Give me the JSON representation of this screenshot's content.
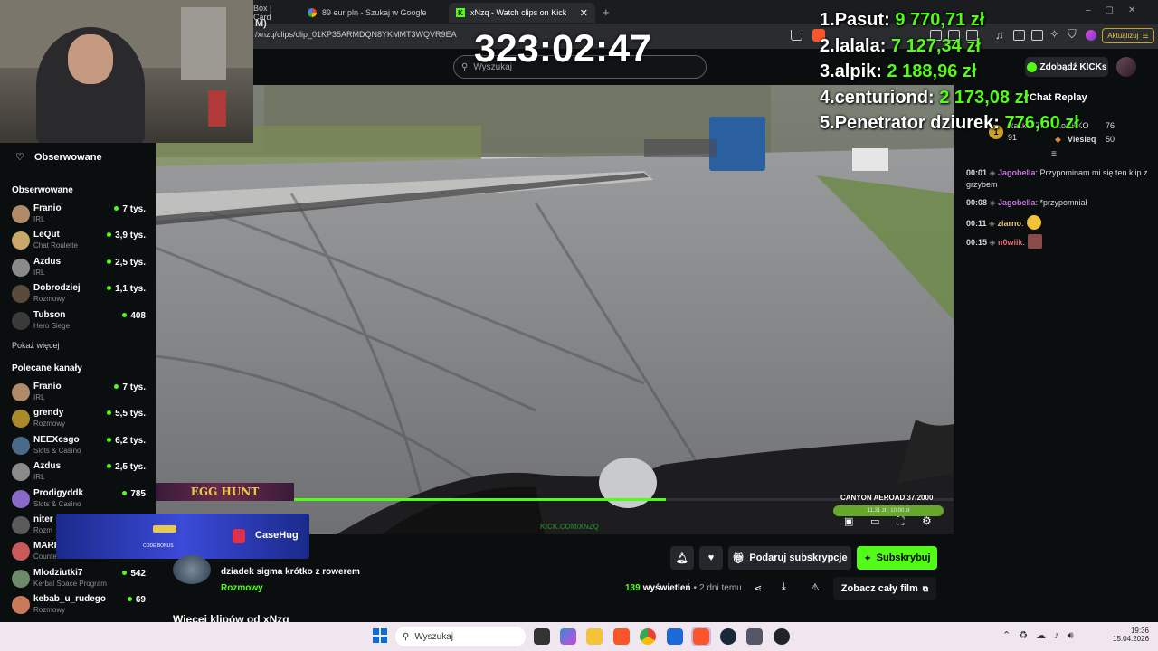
{
  "browser": {
    "tabs": [
      {
        "label": "Box | Card"
      },
      {
        "label": "89 eur pln - Szukaj w Google"
      },
      {
        "label": "xNzq - Watch clips on Kick"
      }
    ],
    "new_tab_glyph": "+",
    "url": "/xnzq/clips/clip_01KP35ARMDQN8YKMMT3WQVR9EA",
    "url_prefix_fragment": "M)",
    "update_label": "Aktualizuj"
  },
  "header": {
    "search_placeholder": "Wyszukaj",
    "kicks_label": "Zdobądź KICKs"
  },
  "stream_overlay": {
    "timer": "323:02:47",
    "leaderboard": [
      {
        "rank": "1.",
        "name": "Pasut:",
        "amount": "9 770,71 zł"
      },
      {
        "rank": "2.",
        "name": "lalala:",
        "amount": "7 127,34 zł"
      },
      {
        "rank": "3.",
        "name": "alpik:",
        "amount": "2 188,96 zł"
      },
      {
        "rank": "4.",
        "name": "centuriond:",
        "amount": "2 173,08 zł"
      },
      {
        "rank": "5.",
        "name": "Penetrator dziurek:",
        "amount": "776,60 zł"
      }
    ]
  },
  "sidebar": {
    "following_header": "Obserwowane",
    "following_section": "Obserwowane",
    "following": [
      {
        "name": "Franio",
        "category": "IRL",
        "viewers": "7 tys.",
        "color": "#b08a6a"
      },
      {
        "name": "LeQut",
        "category": "Chat Roulette",
        "viewers": "3,9 tys.",
        "color": "#c9a86a"
      },
      {
        "name": "Azdus",
        "category": "IRL",
        "viewers": "2,5 tys.",
        "color": "#8a8a8a"
      },
      {
        "name": "Dobrodziej",
        "category": "Rozmowy",
        "viewers": "1,1 tys.",
        "color": "#5a4a3a"
      },
      {
        "name": "Tubson",
        "category": "Hero Siege",
        "viewers": "408",
        "color": "#3a3a3a"
      }
    ],
    "show_more": "Pokaż więcej",
    "recommended_section": "Polecane kanały",
    "recommended": [
      {
        "name": "Franio",
        "category": "IRL",
        "viewers": "7 tys.",
        "color": "#b08a6a"
      },
      {
        "name": "grendy",
        "category": "Rozmowy",
        "viewers": "5,5 tys.",
        "color": "#a88a2a"
      },
      {
        "name": "NEEXcsgo",
        "category": "Slots & Casino",
        "viewers": "6,2 tys.",
        "color": "#4a6a8a"
      },
      {
        "name": "Azdus",
        "category": "IRL",
        "viewers": "2,5 tys.",
        "color": "#8a8a8a"
      },
      {
        "name": "Prodigyddk",
        "category": "Slots & Casino",
        "viewers": "785",
        "color": "#8a6ac8"
      },
      {
        "name": "niter",
        "category": "Rozm",
        "viewers": "",
        "color": "#5a5a5a"
      },
      {
        "name": "MARI",
        "category": "Counte",
        "viewers": "",
        "color": "#c85a5a"
      },
      {
        "name": "Mlodziutki7",
        "category": "Kerbal Space Program",
        "viewers": "542",
        "color": "#6a8a6a"
      },
      {
        "name": "kebab_u_rudego",
        "category": "Rozmowy",
        "viewers": "69",
        "color": "#c87a5a"
      }
    ]
  },
  "video": {
    "bike_label": "CANYON AEROAD 37/2000",
    "speed_label": "11,31 zł ; 10,00 zł",
    "watermark": "KICK.COM/XNZQ",
    "egg_hunt": "EGG HUNT",
    "casino_brand": "CaseHug",
    "casino_sub": "CODE BONUS",
    "progress": 0.64
  },
  "chat": {
    "title": "Chat Replay",
    "gifters": [
      {
        "name": "Rakka777",
        "count": "",
        "glyph": "1"
      },
      {
        "name": "KoziKKO",
        "count": "76",
        "glyph": "◆"
      },
      {
        "name": "",
        "count": "91",
        "glyph": ""
      },
      {
        "name": "Viesieq",
        "count": "50",
        "glyph": "◆"
      }
    ],
    "messages": [
      {
        "time": "00:01",
        "user": "Jagobella",
        "user_color": "#c678dd",
        "text": ": Przypominam mi się ten klip z grzybem"
      },
      {
        "time": "00:08",
        "user": "Jagobella",
        "user_color": "#c678dd",
        "text": ": *przypomniał"
      },
      {
        "time": "00:11",
        "user": "ziarno",
        "user_color": "#e5c07b",
        "text": ":"
      },
      {
        "time": "00:15",
        "user": "n0wiik",
        "user_color": "#e06c75",
        "text": ":"
      }
    ]
  },
  "clip": {
    "title": "dziadek sigma krótko z rowerem",
    "category": "Rozmowy",
    "views": "139",
    "views_label": "wyświetleń",
    "age": "2 dni temu",
    "gift_sub": "Podaruj subskrypcje",
    "subscribe": "Subskrybuj",
    "full_video": "Zobacz cały film",
    "more_clips": "Więcej klipów od xNzq"
  },
  "taskbar": {
    "search": "Wyszukaj",
    "time": "19:36",
    "date": "15.04.2026"
  },
  "colors": {
    "accent": "#53fc18",
    "background": "#0b0e0f"
  }
}
